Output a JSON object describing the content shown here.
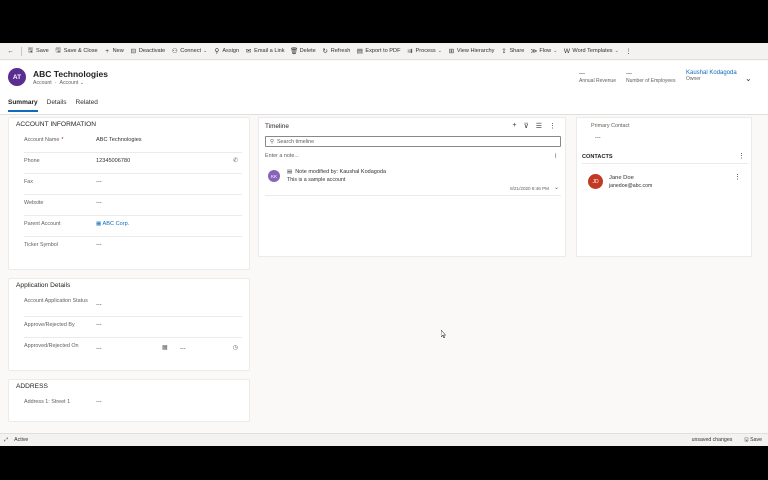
{
  "commands": [
    {
      "key": "save",
      "icon": "save-icon",
      "glyph": "🖫",
      "label": "Save"
    },
    {
      "key": "save_close",
      "icon": "save-close-icon",
      "glyph": "🖫",
      "label": "Save & Close"
    },
    {
      "key": "new",
      "icon": "plus-icon",
      "glyph": "+",
      "label": "New"
    },
    {
      "key": "deactivate",
      "icon": "deactivate-icon",
      "glyph": "⊟",
      "label": "Deactivate"
    },
    {
      "key": "connect",
      "icon": "connect-icon",
      "glyph": "⚇",
      "label": "Connect"
    },
    {
      "key": "assign",
      "icon": "assign-icon",
      "glyph": "⚲",
      "label": "Assign"
    },
    {
      "key": "email_link",
      "icon": "email-icon",
      "glyph": "✉",
      "label": "Email a Link"
    },
    {
      "key": "delete",
      "icon": "trash-icon",
      "glyph": "🗑",
      "label": "Delete"
    },
    {
      "key": "refresh",
      "icon": "refresh-icon",
      "glyph": "↻",
      "label": "Refresh"
    },
    {
      "key": "export_pdf",
      "icon": "pdf-icon",
      "glyph": "▤",
      "label": "Export to PDF"
    },
    {
      "key": "process",
      "icon": "process-icon",
      "glyph": "⇉",
      "label": "Process"
    },
    {
      "key": "view_hierarchy",
      "icon": "hierarchy-icon",
      "glyph": "⊞",
      "label": "View Hierarchy"
    },
    {
      "key": "share",
      "icon": "share-icon",
      "glyph": "⇪",
      "label": "Share"
    },
    {
      "key": "flow",
      "icon": "flow-icon",
      "glyph": "≫",
      "label": "Flow"
    },
    {
      "key": "word_templates",
      "icon": "word-icon",
      "glyph": "W",
      "label": "Word Templates"
    }
  ],
  "record": {
    "initials": "AT",
    "title": "ABC Technologies",
    "entity": "Account",
    "form": "Account",
    "annual_revenue_value": "---",
    "annual_revenue_label": "Annual Revenue",
    "employees_value": "---",
    "employees_label": "Number of Employees",
    "owner_name": "Kaushal Kodagoda",
    "owner_label": "Owner"
  },
  "tabs": [
    "Summary",
    "Details",
    "Related"
  ],
  "account_info": {
    "title": "ACCOUNT INFORMATION",
    "account_name_label": "Account Name",
    "account_name_value": "ABC Technologies",
    "phone_label": "Phone",
    "phone_value": "12345006780",
    "fax_label": "Fax",
    "fax_value": "---",
    "website_label": "Website",
    "website_value": "---",
    "parent_label": "Parent Account",
    "parent_value": "ABC Corp.",
    "ticker_label": "Ticker Symbol",
    "ticker_value": "---"
  },
  "application": {
    "title": "Application Details",
    "status_label": "Account Application Status",
    "status_value": "---",
    "approved_by_label": "Approve/Rejected By",
    "approved_by_value": "---",
    "approved_on_label": "Approved/Rejected On",
    "approved_on_date": "---",
    "approved_on_time": "---"
  },
  "address": {
    "title": "ADDRESS",
    "street_label": "Address 1: Street 1",
    "street_value": "---"
  },
  "timeline": {
    "title": "Timeline",
    "search_placeholder": "Search timeline",
    "note_placeholder": "Enter a note...",
    "item_initials": "KK",
    "item_head": "Note modified by: Kaushal Kodagoda",
    "item_body": "This is a sample account",
    "item_time": "8/21/2020 8:46 PM"
  },
  "right": {
    "primary_contact_label": "Primary Contact",
    "primary_contact_value": "---",
    "contacts_title": "CONTACTS",
    "contact_initials": "JD",
    "contact_name": "Jane Doe",
    "contact_email": "janedoe@abc.com"
  },
  "status_bar": {
    "state": "Active",
    "unsaved": "unsaved changes",
    "save": "Save"
  }
}
